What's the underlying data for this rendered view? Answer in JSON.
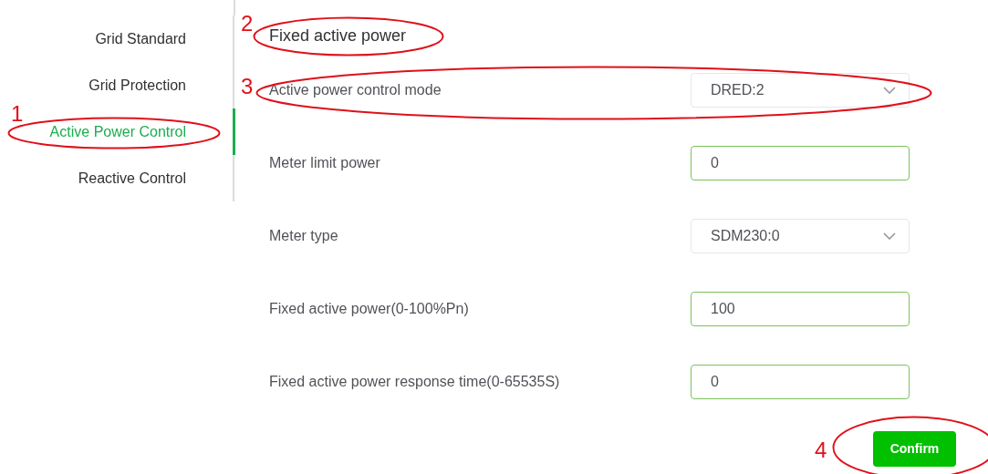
{
  "sidebar": {
    "items": [
      {
        "label": "Grid Standard",
        "selected": false
      },
      {
        "label": "Grid Protection",
        "selected": false
      },
      {
        "label": "Active Power Control",
        "selected": true,
        "callout": "1"
      },
      {
        "label": "Reactive Control",
        "selected": false
      }
    ]
  },
  "form": {
    "title": "Fixed active power",
    "title_callout": "2",
    "fields": [
      {
        "kind": "select",
        "label": "Active power control mode",
        "value": "DRED:2",
        "callout": "3"
      },
      {
        "kind": "input",
        "label": "Meter limit power",
        "value": "0"
      },
      {
        "kind": "select",
        "label": "Meter type",
        "value": "SDM230:0"
      },
      {
        "kind": "input",
        "label": "Fixed active power(0-100%Pn)",
        "value": "100"
      },
      {
        "kind": "input",
        "label": "Fixed active power response time(0-65535S)",
        "value": "0"
      }
    ]
  },
  "confirm_button": {
    "label": "Confirm",
    "callout": "4"
  }
}
